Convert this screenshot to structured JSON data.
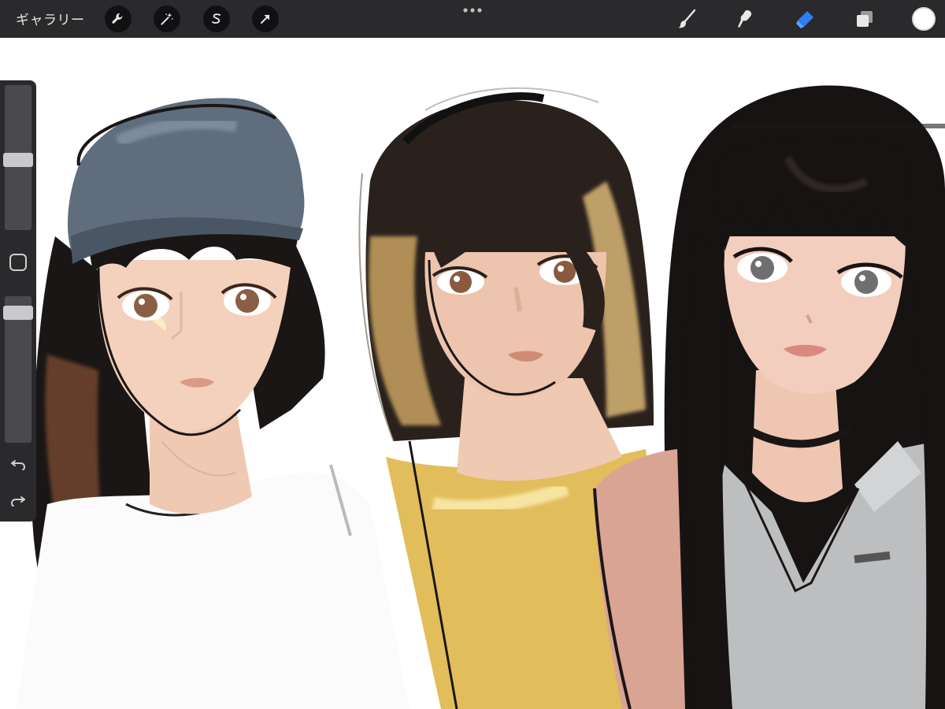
{
  "toolbar": {
    "gallery_label": "ギャラリー",
    "left_tools": [
      {
        "icon": "wrench-icon",
        "label": "actions"
      },
      {
        "icon": "magic-wand-icon",
        "label": "adjustments"
      },
      {
        "icon": "selection-icon",
        "label": "selection"
      },
      {
        "icon": "arrow-cursor-icon",
        "label": "transform"
      }
    ],
    "more_icon": "ellipsis-icon",
    "right_tools": [
      {
        "icon": "brush-icon",
        "label": "paint",
        "active": false
      },
      {
        "icon": "smudge-icon",
        "label": "smudge",
        "active": false
      },
      {
        "icon": "eraser-icon",
        "label": "erase",
        "active": true
      },
      {
        "icon": "layers-icon",
        "label": "layers",
        "active": false
      }
    ],
    "current_color": "#ffffff",
    "accent_color": "#2f7cf6"
  },
  "sidebar": {
    "brush_size_level": 0.48,
    "opacity_level": 0.95,
    "icons": [
      "modify-square-icon",
      "undo-icon",
      "redo-icon"
    ]
  },
  "canvas": {
    "description_colors": {
      "cap": "#5d6b7a",
      "skin": "#f0cdb8",
      "hair_dark": "#1a1514",
      "hair_light": "#c9a56a",
      "top_yellow": "#e3bd57",
      "jacket_grey": "#b9bbbd"
    }
  }
}
